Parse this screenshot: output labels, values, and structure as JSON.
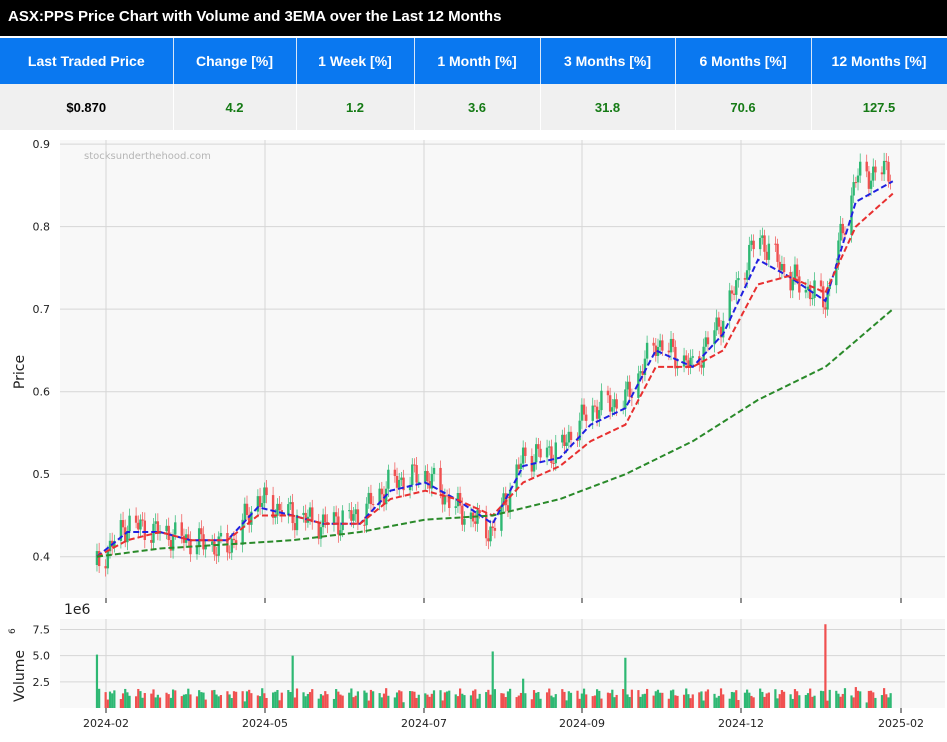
{
  "page": {
    "title": "ASX:PPS Price Chart with Volume and 3EMA over the Last 12 Months"
  },
  "stats": {
    "headers": [
      "Last Traded Price",
      "Change [%]",
      "1 Week [%]",
      "1 Month [%]",
      "3 Months [%]",
      "6 Months [%]",
      "12 Months [%]"
    ],
    "values": [
      "$0.870",
      "4.2",
      "1.2",
      "3.6",
      "31.8",
      "70.6",
      "127.5"
    ]
  },
  "colors": {
    "header_bg": "#0a78f0",
    "up_candle": "#2eb873",
    "down_candle": "#f05050",
    "ema_fast": "#2020e0",
    "ema_mid": "#e83030",
    "ema_slow": "#2a8a2a",
    "positive_text": "#157a15"
  },
  "chart_data": {
    "type": "line",
    "watermark": "stocksunderthehood.com",
    "ylabel": "Price",
    "ylim": [
      0.35,
      0.905
    ],
    "yticks": [
      "0.4",
      "0.5",
      "0.6",
      "0.7",
      "0.8",
      "0.9"
    ],
    "xticks": [
      "2024-02",
      "2024-05",
      "2024-07",
      "2024-09",
      "2024-12",
      "2025-02"
    ],
    "grid": true,
    "series": [
      {
        "style": "candlestick",
        "x": [
          "2024-02-01",
          "2024-02-15",
          "2024-03-01",
          "2024-03-15",
          "2024-04-01",
          "2024-04-15",
          "2024-05-01",
          "2024-05-15",
          "2024-06-01",
          "2024-06-15",
          "2024-07-01",
          "2024-07-15",
          "2024-08-01",
          "2024-08-15",
          "2024-09-01",
          "2024-09-15",
          "2024-10-01",
          "2024-10-15",
          "2024-11-01",
          "2024-11-15",
          "2024-12-01",
          "2024-12-15",
          "2025-01-01",
          "2025-01-15",
          "2025-02-01"
        ],
        "values": [
          0.39,
          0.44,
          0.43,
          0.42,
          0.41,
          0.47,
          0.45,
          0.44,
          0.45,
          0.49,
          0.5,
          0.46,
          0.43,
          0.52,
          0.53,
          0.58,
          0.59,
          0.66,
          0.63,
          0.69,
          0.79,
          0.74,
          0.71,
          0.86,
          0.87
        ]
      },
      {
        "style": "dashed",
        "x": [
          "2024-02-01",
          "2024-02-15",
          "2024-03-01",
          "2024-03-15",
          "2024-04-01",
          "2024-04-15",
          "2024-05-01",
          "2024-05-15",
          "2024-06-01",
          "2024-06-15",
          "2024-07-01",
          "2024-07-15",
          "2024-08-01",
          "2024-08-15",
          "2024-09-01",
          "2024-09-15",
          "2024-10-01",
          "2024-10-15",
          "2024-11-01",
          "2024-11-15",
          "2024-12-01",
          "2024-12-15",
          "2025-01-01",
          "2025-01-15",
          "2025-02-01"
        ],
        "values": [
          0.4,
          0.43,
          0.43,
          0.42,
          0.42,
          0.46,
          0.45,
          0.44,
          0.44,
          0.48,
          0.49,
          0.47,
          0.44,
          0.51,
          0.52,
          0.56,
          0.58,
          0.65,
          0.63,
          0.67,
          0.76,
          0.74,
          0.71,
          0.83,
          0.855
        ]
      },
      {
        "style": "dashed",
        "x": [
          "2024-02-01",
          "2024-02-15",
          "2024-03-01",
          "2024-03-15",
          "2024-04-01",
          "2024-04-15",
          "2024-05-01",
          "2024-05-15",
          "2024-06-01",
          "2024-06-15",
          "2024-07-01",
          "2024-07-15",
          "2024-08-01",
          "2024-08-15",
          "2024-09-01",
          "2024-09-15",
          "2024-10-01",
          "2024-10-15",
          "2024-11-01",
          "2024-11-15",
          "2024-12-01",
          "2024-12-15",
          "2025-01-01",
          "2025-01-15",
          "2025-02-01"
        ],
        "values": [
          0.4,
          0.42,
          0.43,
          0.42,
          0.42,
          0.45,
          0.45,
          0.44,
          0.44,
          0.47,
          0.48,
          0.47,
          0.45,
          0.49,
          0.51,
          0.54,
          0.56,
          0.63,
          0.63,
          0.65,
          0.73,
          0.74,
          0.72,
          0.8,
          0.84
        ]
      },
      {
        "style": "dashed",
        "x": [
          "2024-02-01",
          "2024-03-01",
          "2024-04-01",
          "2024-05-01",
          "2024-06-01",
          "2024-07-01",
          "2024-08-01",
          "2024-09-01",
          "2024-10-01",
          "2024-11-01",
          "2024-12-01",
          "2025-01-01",
          "2025-02-01"
        ],
        "values": [
          0.4,
          0.41,
          0.415,
          0.42,
          0.43,
          0.445,
          0.45,
          0.47,
          0.5,
          0.54,
          0.59,
          0.63,
          0.7
        ]
      }
    ],
    "volume": {
      "ylabel": "Volume",
      "scale_label": "1e6",
      "ylim": [
        0,
        8.5
      ],
      "yticks": [
        "2.5",
        "5.0",
        "7.5"
      ],
      "x": [
        "2024-02-01",
        "2024-02-15",
        "2024-03-01",
        "2024-03-15",
        "2024-04-01",
        "2024-04-15",
        "2024-05-01",
        "2024-05-15",
        "2024-06-01",
        "2024-06-15",
        "2024-07-01",
        "2024-07-15",
        "2024-08-01",
        "2024-08-15",
        "2024-09-01",
        "2024-09-15",
        "2024-10-01",
        "2024-10-15",
        "2024-11-01",
        "2024-11-15",
        "2024-12-01",
        "2024-12-15",
        "2025-01-01",
        "2025-01-15",
        "2025-02-01"
      ],
      "values": [
        5.1,
        1.5,
        1.0,
        1.3,
        1.6,
        1.2,
        5.0,
        1.2,
        1.0,
        1.3,
        1.4,
        1.3,
        5.4,
        2.8,
        2.6,
        1.3,
        4.8,
        1.6,
        1.3,
        1.3,
        2.3,
        1.9,
        8.0,
        2.0,
        1.7
      ]
    }
  }
}
